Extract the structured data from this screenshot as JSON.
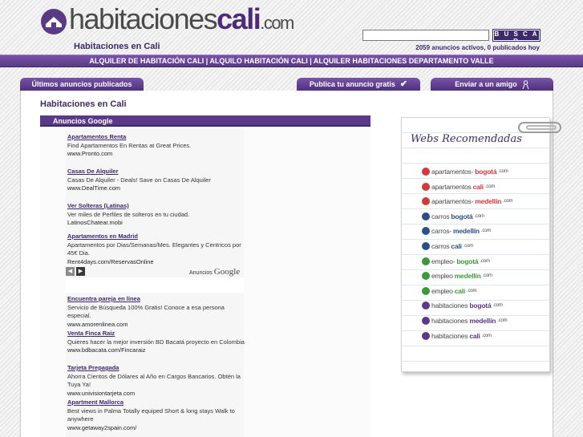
{
  "header": {
    "logo": {
      "prefix": "habitaciones",
      "brand": "cali",
      "tld": ".com"
    },
    "subtitle": "Habitaciones en Cali",
    "search": {
      "value": "",
      "button_label": "B U S C A R"
    },
    "stats": "2059 anuncios activos, 0 publicados hoy"
  },
  "navbar": {
    "text": "ALQUILER DE HABITACIÓN CALI | ALQUILO HABITACIÓN CALI | ALQUILER HABITACIONES DEPARTAMENTO VALLE"
  },
  "tabs": [
    {
      "label": "Últimos anuncios publicados"
    },
    {
      "label": "Publica tu anuncio gratis",
      "icon": "check-icon"
    },
    {
      "label": "Enviar a un amigo",
      "icon": "person-icon"
    }
  ],
  "main": {
    "title": "Habitaciones en Cali",
    "ads_header": "Anuncios Google",
    "adchoices_label": "Anuncios",
    "adchoices_brand": "Google",
    "ads": [
      {
        "title": "Apartamentos Renta",
        "text": "Find Apartamentos En Rentas at Great Prices.",
        "url": "www.Pronto.com"
      },
      {
        "title": "Casas De Alquiler",
        "text": "Casas De Alquiler - Deals! Save on Casas De Alquiler",
        "url": "www.DealTime.com"
      },
      {
        "title": "Ver Solteras (Latinas)",
        "text": "Ver miles de Perfiles de solteros en tu ciudad.",
        "url": "LatinosChatear.mobi"
      },
      {
        "title": "Apartamentos en Madrid",
        "text": "Apartamentos por Dias/Semanas/Mes. Elegantes y Centricos por 45€ Dia.",
        "url": "Rent4days.com/ReservasOnline"
      },
      {
        "title": "Encuentra pareja en línea",
        "text": "Servicio de Búsqueda 100% Gratis! Conoce a esa persona especial.",
        "url": "www.amorenlinea.com"
      },
      {
        "title": "Venta Finca Raiz",
        "text": "Quieres hacer la mejor inversión BD Bacatá proyecto en Colombia",
        "url": "www.bdbacata.com/Fincaraiz"
      },
      {
        "title": "Tarjeta Prepagada",
        "text": "Ahorra Cientos de Dólares al Año en Cargos Bancarios. Obtén la Tuya Ya!",
        "url": "www.univisiontarjeta.com"
      },
      {
        "title": "Apartment Mallorca",
        "text": "Best views in Palma Totally equiped Short & long stays Walk to anywhere",
        "url": "www.getaway2spain.com/"
      }
    ]
  },
  "sidebar": {
    "title": "Webs Recomendadas",
    "links": [
      {
        "prefix": "apartamentos-",
        "city": "bogotá",
        "tld": ".com",
        "color": "#d23a3a"
      },
      {
        "prefix": "apartamentos",
        "city": "cali",
        "tld": ".com",
        "color": "#d23a3a"
      },
      {
        "prefix": "apartamentos-",
        "city": "medellín",
        "tld": ".com",
        "color": "#d23a3a"
      },
      {
        "prefix": "carros",
        "city": "bogotá",
        "tld": ".com",
        "color": "#2c4f86"
      },
      {
        "prefix": "carros-",
        "city": "medellín",
        "tld": ".com",
        "color": "#2c4f86"
      },
      {
        "prefix": "carros",
        "city": "cali",
        "tld": ".com",
        "color": "#2c4f86"
      },
      {
        "prefix": "empleo-",
        "city": "bogotá",
        "tld": ".com",
        "color": "#3a9a3a"
      },
      {
        "prefix": "empleo",
        "city": "medellín",
        "tld": ".com",
        "color": "#3a9a3a"
      },
      {
        "prefix": "empleo",
        "city": "cali",
        "tld": ".com",
        "color": "#3a9a3a"
      },
      {
        "prefix": "habitaciones",
        "city": "bogotá",
        "tld": ".com",
        "color": "#5a3a86"
      },
      {
        "prefix": "habitaciones",
        "city": "medellín",
        "tld": ".com",
        "color": "#5a3a86"
      },
      {
        "prefix": "habitaciones",
        "city": "cali",
        "tld": ".com",
        "color": "#5a3a86"
      }
    ]
  },
  "colors": {
    "brand": "#5a3a86",
    "accent": "#3c2a6a"
  }
}
